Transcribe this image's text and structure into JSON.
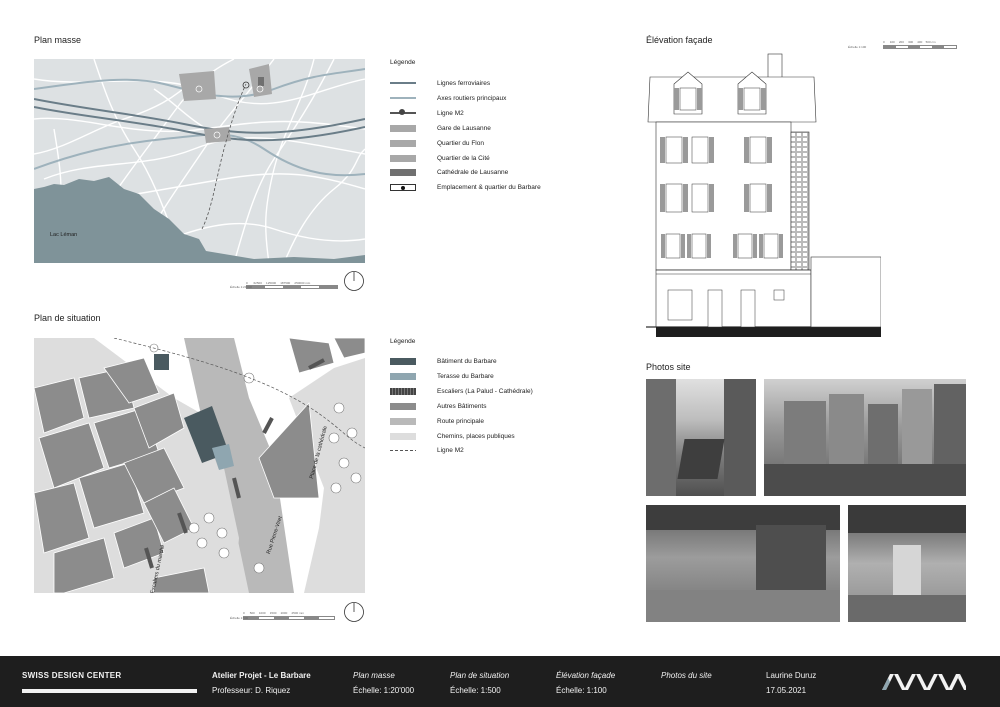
{
  "sections": {
    "plan_masse": "Plan masse",
    "plan_situation": "Plan de situation",
    "elevation": "Élévation façade",
    "photos": "Photos site"
  },
  "map1": {
    "lake_label": "Lac Léman",
    "scale_label": "Échelle 1:20'000",
    "scale_ticks": [
      "0",
      "62500",
      "125000",
      "187500",
      "250000 mm"
    ]
  },
  "map2": {
    "street1": "Rue Pierre-Viret",
    "street2": "Place de la cathédrale",
    "street3": "Escaliers du marché",
    "scale_label": "Échelle 1:500",
    "scale_ticks": [
      "0",
      "500",
      "1000",
      "1500",
      "2000",
      "2500 mm"
    ]
  },
  "elevation_scale": {
    "label": "Échelle 1:100",
    "ticks": [
      "0",
      "100",
      "200",
      "300",
      "400",
      "500 cm"
    ]
  },
  "legend1": {
    "title": "Légende",
    "items": [
      {
        "label": "Lignes ferroviaires",
        "color": "#6a7d88"
      },
      {
        "label": "Axes routiers principaux",
        "color": "#9eb2bc"
      },
      {
        "label": "Ligne M2",
        "color": "#555555"
      },
      {
        "label": "Gare de Lausanne",
        "color": "#a8a8a8"
      },
      {
        "label": "Quartier du Flon",
        "color": "#a8a8a8"
      },
      {
        "label": "Quartier de la Cité",
        "color": "#a8a8a8"
      },
      {
        "label": "Cathédrale de Lausanne",
        "color": "#707070"
      },
      {
        "label": "Emplacement & quartier du Barbare",
        "color": "#ffffff"
      }
    ]
  },
  "legend2": {
    "title": "Légende",
    "items": [
      {
        "label": "Bâtiment du Barbare",
        "color": "#4a5a60"
      },
      {
        "label": "Terasse du Barbare",
        "color": "#8fa6b0"
      },
      {
        "label": "Escaliers (La Palud - Cathédrale)",
        "color": "#555555"
      },
      {
        "label": "Autres Bâtiments",
        "color": "#8c8c8c"
      },
      {
        "label": "Route principale",
        "color": "#b9b9b9"
      },
      {
        "label": "Chemins, places publiques",
        "color": "#dddddd"
      },
      {
        "label": "Ligne M2",
        "color": "#ffffff"
      }
    ]
  },
  "footer": {
    "brand": "SWISS DESIGN CENTER",
    "atelier": "Atelier Projet - Le Barbare",
    "professor": "Professeur: D. Riquez",
    "cols": [
      {
        "title": "Plan masse",
        "value": "Échelle: 1:20'000"
      },
      {
        "title": "Plan de situation",
        "value": "Échelle: 1:500"
      },
      {
        "title": "Élévation façade",
        "value": "Échelle: 1:100"
      },
      {
        "title": "Photos du site",
        "value": ""
      }
    ],
    "author": "Laurine Duruz",
    "date": "17.05.2021"
  },
  "colors": {
    "lake": "#7f9399",
    "map_bg": "#dde1e3",
    "footer_bg": "#1e1e1e",
    "logo_accent": "#8fa6b0"
  }
}
